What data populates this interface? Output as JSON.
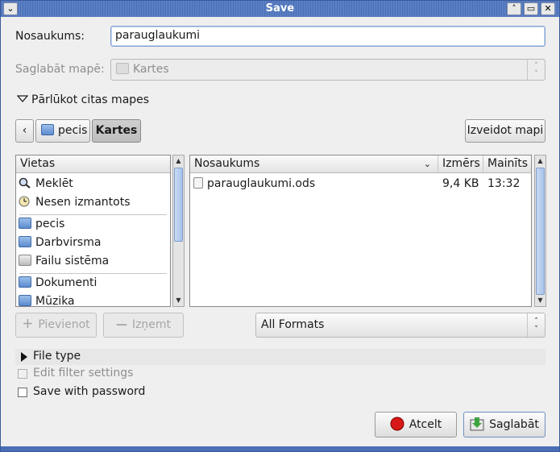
{
  "window": {
    "title": "Save",
    "menu_glyph": "⌄",
    "shade_glyph": "˄",
    "maximize_glyph": "▭",
    "close_glyph": "✕"
  },
  "name_row": {
    "label": "Nosaukums:",
    "value": "parauglaukumi"
  },
  "folder_row": {
    "label": "Saglabāt mapē:",
    "value": "Kartes"
  },
  "browse_toggle": {
    "label": "Pārlūkot citas mapes"
  },
  "path_bar": {
    "back_glyph": "‹",
    "crumbs": [
      "pecis",
      "Kartes"
    ],
    "create_folder_label": "Izveidot mapi"
  },
  "places": {
    "header": "Vietas",
    "items": [
      {
        "label": "Meklēt",
        "icon": "search-icon"
      },
      {
        "label": "Nesen izmantots",
        "icon": "clock-icon"
      },
      {
        "label": "pecis",
        "icon": "home-folder-icon"
      },
      {
        "label": "Darbvirsma",
        "icon": "desktop-folder-icon"
      },
      {
        "label": "Failu sistēma",
        "icon": "drive-icon"
      },
      {
        "label": "Dokumenti",
        "icon": "documents-folder-icon"
      },
      {
        "label": "Mūzika",
        "icon": "music-folder-icon"
      }
    ],
    "add_label": "Pievienot",
    "remove_label": "Izņemt"
  },
  "files": {
    "columns": [
      "Nosaukums",
      "Izmērs",
      "Mainīts"
    ],
    "rows": [
      {
        "name": "parauglaukumi.ods",
        "size": "9,4 KB",
        "modified": "13:32"
      }
    ]
  },
  "filter": {
    "selected": "All Formats"
  },
  "file_type": {
    "label": "File type"
  },
  "edit_filter": {
    "label": "Edit filter settings"
  },
  "save_password": {
    "label": "Save with password"
  },
  "buttons": {
    "cancel": "Atcelt",
    "save": "Saglabāt"
  }
}
